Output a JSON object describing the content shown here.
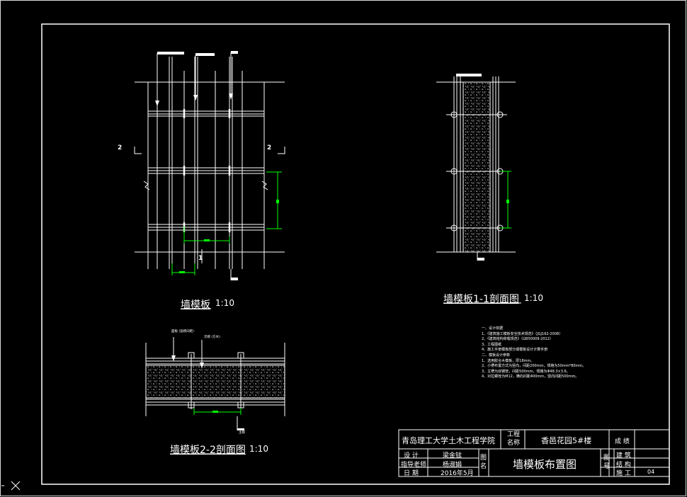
{
  "drawings": {
    "elevation": {
      "title": "墙模板",
      "scale": "1:10",
      "section_marks": [
        "2",
        "2",
        "1"
      ]
    },
    "section_1_1": {
      "title": "墙模板1-1剖面图",
      "scale": "1:10"
    },
    "section_2_2": {
      "title": "墙模板2-2剖面图",
      "scale": "1:10",
      "labels": [
        "面板 (竖楞间距)",
        "次楞 (方木)",
        "主楞"
      ]
    }
  },
  "notes": {
    "lines": [
      "一、设计依据",
      "1、《建筑施工模板安全技术规范》（JGJ162-2008）",
      "2、《建筑结构荷载规范》（GB50009-2012）",
      "3、工程图纸",
      "4、施工手册模板部分或模板设计计算手册",
      "二、模板设计参数",
      "1、选用胶合木模板，厚18mm。",
      "2、小楞布置方式为竖向，间距200mm，规格为50mm*80mm。",
      "3、主楞为双钢管，间距500mm，规格为Φ48.3×3.6。",
      "4、对拉螺栓为M12，横向间距400mm，竖向间距500mm。"
    ]
  },
  "title_block": {
    "school": "青岛理工大学土木工程学院",
    "project_label": "工程名称",
    "project_name": "香邑花园5#楼",
    "score_label": "成 绩",
    "drawing_name_label": "图名",
    "drawing_name": "墙模板布置图",
    "drawing_no_label": "图号",
    "rows": [
      {
        "label": "设 计",
        "value": "梁金铉"
      },
      {
        "label": "指导老师",
        "value": "杨淑娟"
      },
      {
        "label": "日 期",
        "value": "2016年5月"
      }
    ],
    "disciplines": [
      "建 筑",
      "结 构",
      "施 工"
    ],
    "sheet_no": "04"
  },
  "colors": {
    "background": "#000000",
    "line": "#ffffff",
    "dimension": "#00ff00"
  }
}
